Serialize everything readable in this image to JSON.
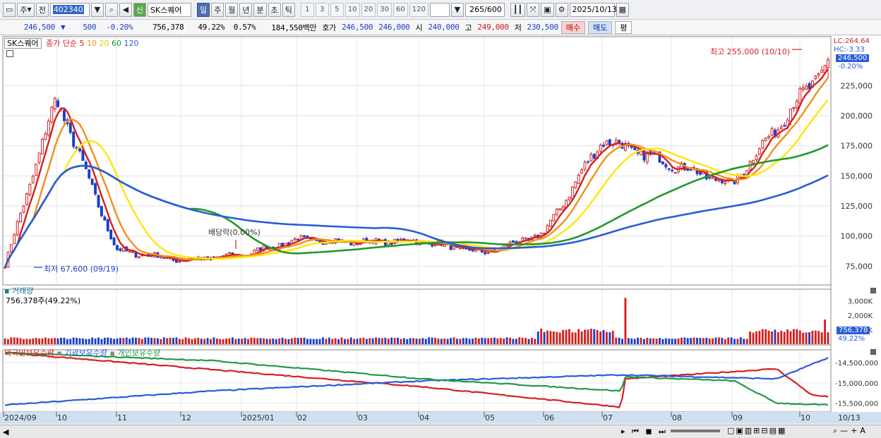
{
  "toolbar": {
    "period_label": "주",
    "prev_label": "전",
    "code_value": "402340",
    "credit_badge": "신",
    "stock_name": "SK스퀘어",
    "period_buttons": [
      "일",
      "주",
      "월",
      "년",
      "분",
      "초",
      "틱"
    ],
    "active_period": "일",
    "interval_buttons": [
      "1",
      "3",
      "5",
      "10",
      "20",
      "30",
      "60",
      "120"
    ],
    "count_display": "265/600",
    "date_value": "2025/10/13"
  },
  "quote_bar": {
    "price": "246,500",
    "change": "500",
    "change_rate": "-0.20%",
    "volume": "756,378",
    "volume_ratio": "49.22%",
    "turnover_rate": "0.57%",
    "amount": "184,550백만",
    "ask_label": "호가",
    "ask1": "246,500",
    "ask2": "246,000",
    "open_label": "시",
    "open": "240,000",
    "high_label": "고",
    "high": "249,000",
    "low_label": "저",
    "low": "230,500",
    "buy_label": "매수",
    "sell_label": "매도",
    "eval_label": "평"
  },
  "price_panel": {
    "name_tag": "SK스퀘어",
    "legend_prefix": "종가 단순",
    "ma_periods": [
      "5",
      "10",
      "20",
      "60",
      "120"
    ],
    "ma_colors": [
      "#d42020",
      "#f0901c",
      "#ffe60a",
      "#22992c",
      "#2a5cd6"
    ],
    "lc_label": "LC:264.64",
    "hc_label": "HC:-3.33",
    "current_price_tag": "246,500",
    "current_change_tag": "-0.20%",
    "high_annotation": "최고 255,000 (10/10)",
    "low_annotation": "최저 67,600 (09/19)",
    "dividend_annotation": "배당락(0.00%)",
    "y_ticks": [
      "225,000",
      "200,000",
      "175,000",
      "150,000",
      "125,000",
      "100,000",
      "75,000"
    ]
  },
  "volume_panel": {
    "title": "거래량",
    "value_text": "756,378주(49.22%)",
    "y_ticks": [
      "3,000K",
      "2,000K",
      "1,000K"
    ],
    "current_tag": "756,378",
    "current_ratio_tag": "49.22%"
  },
  "holding_panel": {
    "legend": [
      "외국인보유수량",
      "기관보유수량",
      "개인보유수량"
    ],
    "legend_colors": [
      "#d42020",
      "#2a5cd6",
      "#22994a"
    ],
    "y_ticks": [
      "-14,500,000",
      "-15,000,000",
      "-15,500,000"
    ]
  },
  "x_axis": {
    "labels": [
      "2024/09",
      "10",
      "11",
      "12",
      "2025/01",
      "02",
      "03",
      "04",
      "05",
      "06",
      "07",
      "08",
      "09",
      "10"
    ],
    "end_label": "10/13"
  },
  "chart_data": {
    "type": "candlestick",
    "title": "SK스퀘어",
    "ylim": [
      60000,
      265000
    ],
    "axis_ticks": [
      75000,
      100000,
      125000,
      150000,
      175000,
      200000,
      225000
    ],
    "months": [
      "2024/09",
      "10",
      "11",
      "12",
      "2025/01",
      "02",
      "03",
      "04",
      "05",
      "06",
      "07",
      "08",
      "09",
      "10"
    ],
    "approx_close_by_month_start": {
      "2024/09": 72000,
      "10": 215000,
      "11": 88000,
      "12": 80000,
      "2025/01": 84000,
      "02": 97000,
      "03": 95000,
      "04": 96000,
      "05": 86000,
      "06": 102000,
      "07": 180000,
      "08": 160000,
      "09": 143000,
      "10/13": 246500
    },
    "annotations": [
      {
        "text": "최고 255,000 (10/10)",
        "value": 255000
      },
      {
        "text": "최저 67,600 (09/19)",
        "value": 67600
      },
      {
        "text": "배당락(0.00%)"
      }
    ],
    "last_candle": {
      "open": 240000,
      "high": 249000,
      "low": 230500,
      "close": 246500
    },
    "volume_peak": 3000000
  }
}
